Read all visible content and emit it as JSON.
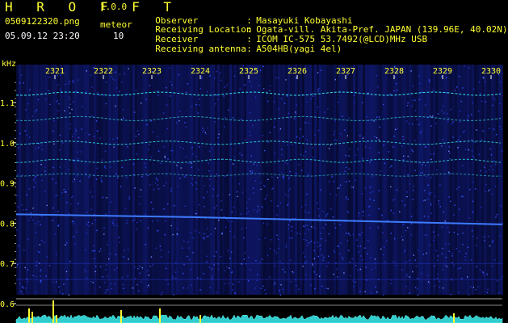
{
  "app": {
    "title": "H R O F F T",
    "version": "1.0.0",
    "file_name": "0509122320.png",
    "mode": "meteor",
    "timestamp": "05.09.12 23:20",
    "count": "10"
  },
  "info": [
    {
      "key": "Observer",
      "value": "Masayuki Kobayashi"
    },
    {
      "key": "Receiving Location",
      "value": "Ogata-vill. Akita-Pref. JAPAN (139.96E, 40.02N)"
    },
    {
      "key": "Receiver",
      "value": "ICOM IC-575 53.7492(@LCD)MHz USB"
    },
    {
      "key": "Receiving antenna",
      "value": "A504HB(yagi 4el)"
    }
  ],
  "chart_data": {
    "type": "heatmap",
    "ylabel": "kHz",
    "x_ticks": [
      "2321",
      "2322",
      "2323",
      "2324",
      "2325",
      "2326",
      "2327",
      "2328",
      "2329",
      "2330"
    ],
    "y_ticks": [
      "1.1",
      "1.0",
      "0.9",
      "0.8",
      "0.7",
      "0.6"
    ],
    "colors": {
      "background": "#000000",
      "signal": "#3355ff",
      "trace": "#33ffff",
      "label": "#ffff33",
      "grid": "#ffffff"
    }
  }
}
